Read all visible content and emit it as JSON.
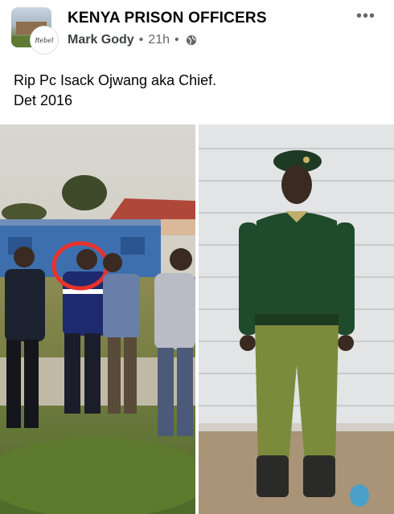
{
  "header": {
    "group_name": "KENYA PRISON OFFICERS",
    "author": "Mark Gody",
    "time": "21h",
    "separator": "•",
    "privacy_icon": "globe-icon",
    "more_icon": "more-options-icon",
    "more_label": "•••",
    "user_avatar_text": "Rebel"
  },
  "post": {
    "line1": "Rip Pc Isack Ojwang aka Chief.",
    "line2": "Det 2016"
  },
  "photos": [
    {
      "name": "group-photo",
      "description_icon": "photo"
    },
    {
      "name": "officer-uniform-photo",
      "description_icon": "photo"
    }
  ],
  "colors": {
    "text_primary": "#050505",
    "text_secondary": "#65676b",
    "highlight_circle": "#e8322b",
    "uniform_green": "#1f4a2b",
    "trouser_green": "#7c8a3c"
  }
}
